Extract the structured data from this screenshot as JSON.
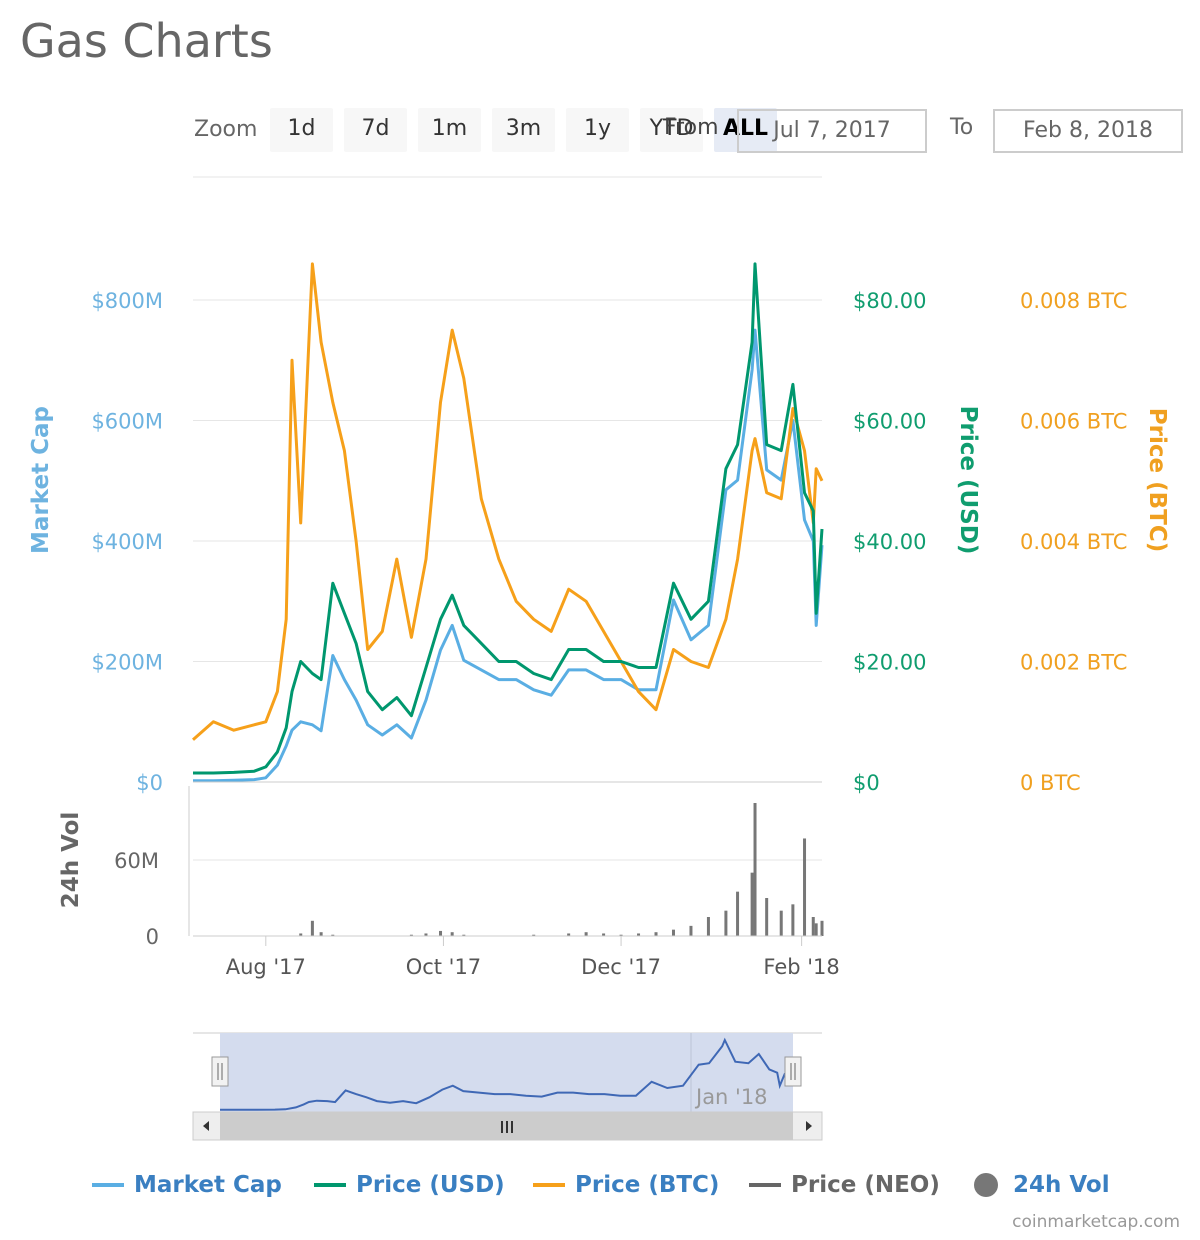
{
  "title": "Gas Charts",
  "range_selector": {
    "zoom_label": "Zoom",
    "buttons": [
      "1d",
      "7d",
      "1m",
      "3m",
      "1y",
      "YTD",
      "ALL"
    ],
    "selected": "ALL",
    "from_label": "From",
    "from_value": "Jul 7, 2017",
    "to_label": "To",
    "to_value": "Feb 8, 2018"
  },
  "legend": [
    {
      "label": "Market Cap",
      "color": "#5aaee3",
      "symbol": "line"
    },
    {
      "label": "Price (USD)",
      "color": "#00976e",
      "symbol": "line"
    },
    {
      "label": "Price (BTC)",
      "color": "#f6a01a",
      "symbol": "line"
    },
    {
      "label": "Price (NEO)",
      "color": "#666666",
      "symbol": "line",
      "hidden": true
    },
    {
      "label": "24h Vol",
      "color": "#777777",
      "symbol": "circle"
    }
  ],
  "credit": "coinmarketcap.com",
  "navigator": {
    "label": "Jan '18"
  },
  "chart_data": {
    "type": "line",
    "x": [
      "2017-07-07",
      "2017-07-14",
      "2017-07-21",
      "2017-07-28",
      "2017-08-01",
      "2017-08-05",
      "2017-08-08",
      "2017-08-10",
      "2017-08-13",
      "2017-08-17",
      "2017-08-20",
      "2017-08-24",
      "2017-08-28",
      "2017-09-01",
      "2017-09-05",
      "2017-09-10",
      "2017-09-15",
      "2017-09-20",
      "2017-09-25",
      "2017-09-30",
      "2017-10-04",
      "2017-10-08",
      "2017-10-14",
      "2017-10-20",
      "2017-10-26",
      "2017-11-01",
      "2017-11-07",
      "2017-11-13",
      "2017-11-19",
      "2017-11-25",
      "2017-12-01",
      "2017-12-07",
      "2017-12-13",
      "2017-12-19",
      "2017-12-25",
      "2017-12-31",
      "2018-01-06",
      "2018-01-10",
      "2018-01-15",
      "2018-01-16",
      "2018-01-20",
      "2018-01-25",
      "2018-01-29",
      "2018-02-02",
      "2018-02-05",
      "2018-02-06",
      "2018-02-08"
    ],
    "x_ticks": [
      "Aug '17",
      "Oct '17",
      "Dec '17",
      "Feb '18"
    ],
    "x_tick_dates": [
      "2017-08-01",
      "2017-10-01",
      "2017-12-01",
      "2018-02-01"
    ],
    "xlim": [
      "2017-07-07",
      "2018-02-08"
    ],
    "axes": {
      "market_cap": {
        "label": "Market Cap",
        "ticks": [
          "$0",
          "$200M",
          "$400M",
          "$600M",
          "$800M"
        ],
        "tick_values": [
          0,
          200,
          400,
          600,
          800
        ],
        "unit": "USD millions",
        "color": "#6eb3e0"
      },
      "usd": {
        "label": "Price (USD)",
        "ticks": [
          "$0",
          "$20.00",
          "$40.00",
          "$60.00",
          "$80.00"
        ],
        "tick_values": [
          0,
          20,
          40,
          60,
          80
        ],
        "color": "#109d6f"
      },
      "btc": {
        "label": "Price (BTC)",
        "ticks": [
          "0 BTC",
          "0.002 BTC",
          "0.004 BTC",
          "0.006 BTC",
          "0.008 BTC"
        ],
        "tick_values": [
          0,
          0.002,
          0.004,
          0.006,
          0.008
        ],
        "color": "#f0a020"
      },
      "volume": {
        "label": "24h Vol",
        "ticks": [
          "0",
          "60M"
        ],
        "tick_values": [
          0,
          60
        ],
        "unit": "USD millions",
        "color": "#666666"
      }
    },
    "grid": true,
    "legend_position": "bottom",
    "series": [
      {
        "name": "Market Cap",
        "axis": "market_cap",
        "color": "#5aaee3",
        "values": [
          2,
          2,
          3,
          4,
          7,
          28,
          60,
          86,
          100,
          95,
          85,
          210,
          170,
          136,
          95,
          78,
          95,
          73,
          136,
          219,
          260,
          202,
          186,
          170,
          170,
          153,
          144,
          186,
          186,
          170,
          170,
          153,
          153,
          302,
          236,
          260,
          485,
          501,
          684,
          750,
          518,
          501,
          600,
          435,
          400,
          260,
          393
        ]
      },
      {
        "name": "Price (USD)",
        "axis": "usd",
        "color": "#00976e",
        "values": [
          1.5,
          1.5,
          1.6,
          1.8,
          2.5,
          5,
          9,
          15,
          20,
          18,
          17,
          33,
          28,
          23,
          15,
          12,
          14,
          11,
          19,
          27,
          31,
          26,
          23,
          20,
          20,
          18,
          17,
          22,
          22,
          20,
          20,
          19,
          19,
          33,
          27,
          30,
          52,
          56,
          73,
          86,
          56,
          55,
          66,
          48,
          45,
          28,
          42
        ]
      },
      {
        "name": "Price (BTC)",
        "axis": "btc",
        "color": "#f6a01a",
        "values": [
          0.0007,
          0.001,
          0.00086,
          0.00095,
          0.001,
          0.0015,
          0.0027,
          0.007,
          0.0043,
          0.0086,
          0.0073,
          0.0063,
          0.0055,
          0.004,
          0.0022,
          0.0025,
          0.0037,
          0.0024,
          0.0037,
          0.0063,
          0.0075,
          0.0067,
          0.0047,
          0.0037,
          0.003,
          0.0027,
          0.0025,
          0.0032,
          0.003,
          0.0025,
          0.002,
          0.0015,
          0.0012,
          0.0022,
          0.002,
          0.0019,
          0.0027,
          0.0037,
          0.0055,
          0.0057,
          0.0048,
          0.0047,
          0.0062,
          0.0055,
          0.0043,
          0.0052,
          0.005
        ]
      },
      {
        "name": "24h Vol",
        "axis": "volume",
        "type": "bar",
        "color": "#777777",
        "values": [
          0,
          0,
          0,
          0,
          0,
          0,
          0,
          0,
          2,
          12,
          3,
          1,
          0,
          0,
          0,
          0,
          0,
          1,
          2,
          4,
          3,
          1,
          0,
          0,
          0,
          1,
          0,
          2,
          3,
          2,
          1,
          2,
          3,
          5,
          8,
          15,
          20,
          35,
          50,
          105,
          30,
          20,
          25,
          77,
          15,
          10,
          12
        ]
      }
    ]
  }
}
